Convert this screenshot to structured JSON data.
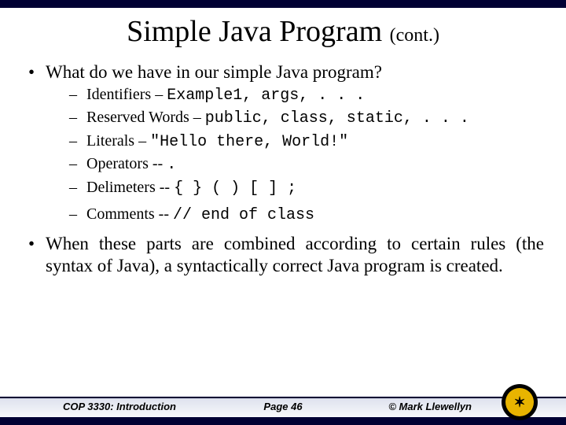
{
  "title": {
    "main": "Simple Java Program ",
    "cont": "(cont.)"
  },
  "bullets": {
    "q": "What do we have in our simple Java program?",
    "items": [
      {
        "label": "Identifiers – ",
        "code": "Example1, args, . . ."
      },
      {
        "label": "Reserved Words – ",
        "code": "public, class, static, . . ."
      },
      {
        "label": "Literals –         ",
        "code": "\"Hello there, World!\""
      },
      {
        "label": "Operators --  ",
        "code": "."
      },
      {
        "label": "Delimeters -- ",
        "code": "{   }   (    )   [ ]   ;"
      },
      {
        "label": "Comments -- ",
        "code": "// end of class"
      }
    ],
    "para": "When these parts are combined according to certain rules (the syntax of Java), a syntactically correct Java program is created."
  },
  "footer": {
    "left": "COP 3330: Introduction",
    "center": "Page 46",
    "right": "© Mark Llewellyn"
  }
}
